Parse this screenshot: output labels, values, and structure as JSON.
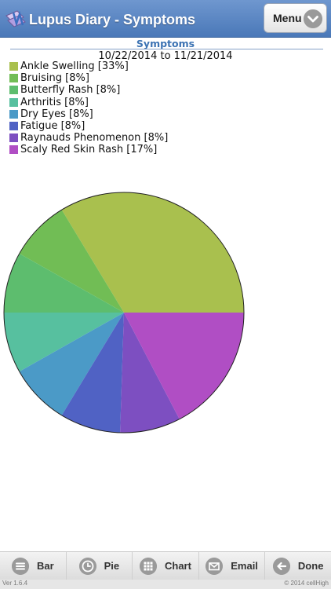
{
  "header": {
    "title": "Lupus Diary - Symptoms",
    "menu_label": "Menu"
  },
  "chart_data": {
    "type": "pie",
    "title": "Symptoms",
    "subtitle": "10/22/2014 to 11/21/2014",
    "legend_position": "top-left",
    "categories": [
      "Ankle Swelling",
      "Bruising",
      "Butterfly Rash",
      "Arthritis",
      "Dry Eyes",
      "Fatigue",
      "Raynauds Phenomenon",
      "Scaly Red Skin Rash"
    ],
    "values": [
      33,
      8,
      8,
      8,
      8,
      8,
      8,
      17
    ],
    "legend_labels": [
      "Ankle Swelling [33%]",
      "Bruising [8%]",
      "Butterfly Rash [8%]",
      "Arthritis [8%]",
      "Dry Eyes [8%]",
      "Fatigue [8%]",
      "Raynauds Phenomenon [8%]",
      "Scaly Red Skin Rash [17%]"
    ],
    "colors": [
      "#a9c04e",
      "#71bd55",
      "#5dbd6e",
      "#57c09f",
      "#4b9ac7",
      "#5062c4",
      "#7d4fc1",
      "#b04ec4"
    ]
  },
  "toolbar": {
    "buttons": [
      {
        "label": "Bar",
        "icon": "list-icon"
      },
      {
        "label": "Pie",
        "icon": "clock-icon"
      },
      {
        "label": "Chart",
        "icon": "grid-icon"
      },
      {
        "label": "Email",
        "icon": "envelope-icon"
      },
      {
        "label": "Done",
        "icon": "back-arrow-icon"
      }
    ]
  },
  "footer": {
    "version": "Ver 1.6.4",
    "copyright": "© 2014 cellHigh"
  }
}
